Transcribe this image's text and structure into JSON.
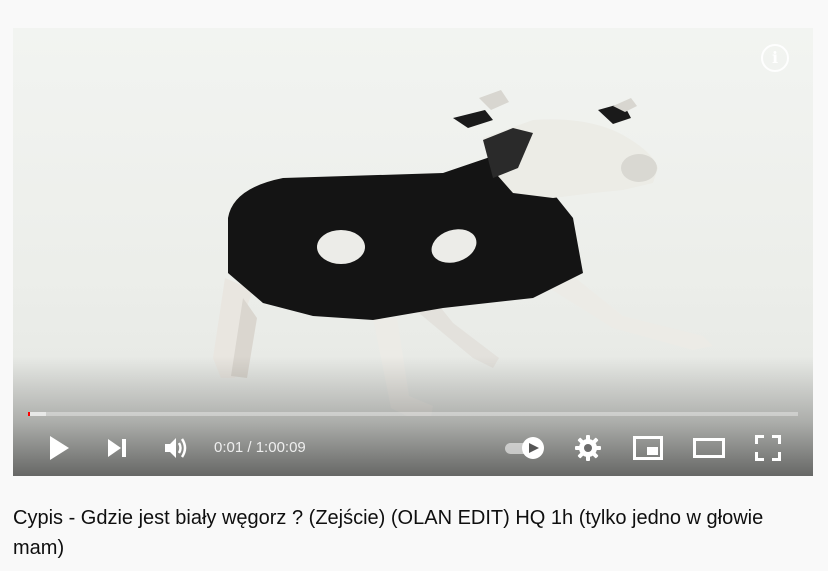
{
  "player": {
    "current_time": "0:01",
    "separator": " / ",
    "duration": "1:00:09",
    "progress_played_fraction": 0.0002,
    "progress_loaded_fraction": 0.024,
    "autoplay_on": true,
    "info_icon": "info-icon",
    "buttons": [
      {
        "name": "play-icon"
      },
      {
        "name": "next-icon"
      },
      {
        "name": "volume-icon"
      },
      {
        "name": "autoplay-toggle-icon"
      },
      {
        "name": "settings-gear-icon"
      },
      {
        "name": "miniplayer-icon"
      },
      {
        "name": "theater-mode-icon"
      },
      {
        "name": "fullscreen-icon"
      }
    ]
  },
  "video": {
    "title": "Cypis - Gdzie jest biały węgorz ? (Zejście) (OLAN EDIT) HQ 1h (tylko jedno w głowie mam)"
  },
  "colors": {
    "progress_played": "#ff0000",
    "controls_icon": "#ffffff",
    "page_background": "#f9f9f9",
    "title_text": "#0f0f0f"
  }
}
